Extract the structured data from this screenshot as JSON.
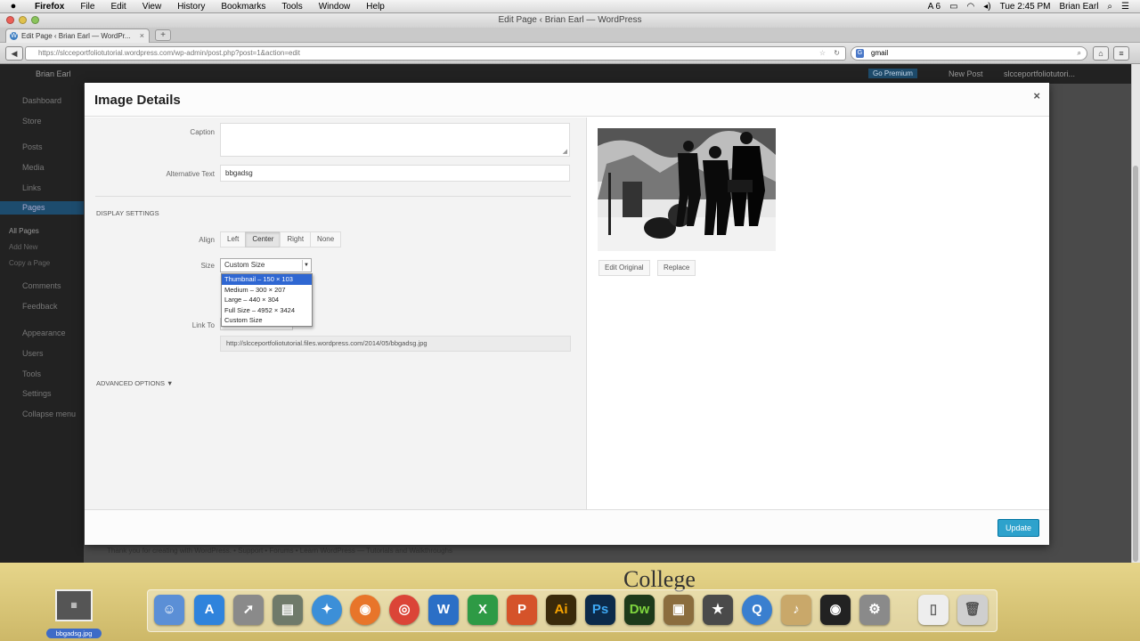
{
  "menubar": {
    "apple": "",
    "items": [
      "Firefox",
      "File",
      "Edit",
      "View",
      "History",
      "Bookmarks",
      "Tools",
      "Window",
      "Help"
    ],
    "status_badge": "6",
    "clock": "Tue 2:45 PM",
    "user": "Brian Earl"
  },
  "window": {
    "title": "Edit Page ‹ Brian Earl — WordPress"
  },
  "tab": {
    "label": "Edit Page ‹ Brian Earl — WordPr..."
  },
  "nav": {
    "url": "https://slcceportfoliotutorial.wordpress.com/wp-admin/post.php?post=1&action=edit",
    "search_value": "gmail",
    "search_engine": "G"
  },
  "wp": {
    "site_name": "Brian Earl",
    "adminbar_right": [
      "Go Premium",
      "New Post",
      "slcceportfoliotutori..."
    ],
    "sidebar": [
      "Dashboard",
      "Store",
      "Posts",
      "Media",
      "Links",
      "Pages",
      "All Pages",
      "Add New",
      "Copy a Page",
      "Comments",
      "Feedback",
      "Appearance",
      "Users",
      "Tools",
      "Settings",
      "Collapse menu"
    ],
    "footer": "Thank you for creating with WordPress. • Support • Forums • Learn WordPress — Tutorials and Walkthroughs"
  },
  "modal": {
    "title": "Image Details",
    "close": "×",
    "caption_label": "Caption",
    "alt_label": "Alternative Text",
    "alt_value": "bbgadsg",
    "display_settings": "DISPLAY SETTINGS",
    "align_label": "Align",
    "align_options": [
      "Left",
      "Center",
      "Right",
      "None"
    ],
    "align_selected": "Center",
    "size_label": "Size",
    "size_value": "Custom Size",
    "size_options": [
      "Thumbnail – 150 × 103",
      "Medium – 300 × 207",
      "Large – 440 × 304",
      "Full Size – 4952 × 3424",
      "Custom Size"
    ],
    "size_highlighted": "Thumbnail – 150 × 103",
    "link_label": "Link To",
    "link_url": "http://slcceportfoliotutorial.files.wordpress.com/2014/05/bbgadsg.jpg",
    "advanced": "ADVANCED OPTIONS ▼",
    "edit_original": "Edit Original",
    "replace": "Replace",
    "update": "Update"
  },
  "desktop": {
    "file_label": "bbgadsg.jpg",
    "wallpaper_text": "College"
  },
  "dock": [
    "Finder",
    "App Store",
    "Launchpad",
    "Preview",
    "Safari",
    "Firefox",
    "Chrome",
    "Word",
    "Excel",
    "PowerPoint",
    "Ai",
    "Ps",
    "Dw",
    "iPhoto",
    "iMovie",
    "QuickTime",
    "GarageBand",
    "Audio",
    "System Preferences",
    "Document",
    "Trash"
  ]
}
